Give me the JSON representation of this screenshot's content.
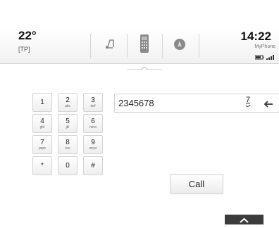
{
  "status_bar": {
    "temperature": "22°",
    "traffic_program": "[TP]",
    "clock": "14:22",
    "carrier": "MyPhone",
    "accent": "#3a3a3a"
  },
  "tabs": [
    {
      "id": "audio",
      "icon": "music-note-icon"
    },
    {
      "id": "phone",
      "icon": "phone-icon",
      "active": true
    },
    {
      "id": "nav",
      "icon": "navigation-icon"
    }
  ],
  "keypad": {
    "keys": [
      {
        "digit": "1",
        "letters": ""
      },
      {
        "digit": "2",
        "letters": "abc"
      },
      {
        "digit": "3",
        "letters": "def"
      },
      {
        "digit": "4",
        "letters": "ghi"
      },
      {
        "digit": "5",
        "letters": "jkl"
      },
      {
        "digit": "6",
        "letters": "mno"
      },
      {
        "digit": "7",
        "letters": "pqrs"
      },
      {
        "digit": "8",
        "letters": "tuv"
      },
      {
        "digit": "9",
        "letters": "wxyz"
      },
      {
        "digit": "*",
        "letters": ""
      },
      {
        "digit": "0",
        "letters": ""
      },
      {
        "digit": "#",
        "letters": ""
      }
    ]
  },
  "dial_entry": {
    "number": "2345678",
    "suggestion": "7"
  },
  "call_button": {
    "label": "Call"
  }
}
